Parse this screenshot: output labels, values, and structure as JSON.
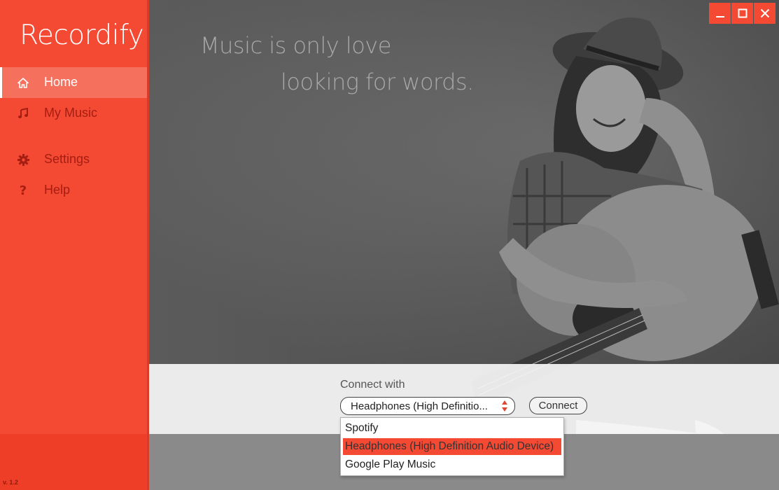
{
  "app": {
    "title": "Recordify",
    "version": "v. 1.2",
    "accent_color": "#f44a34"
  },
  "sidebar": {
    "items": [
      {
        "label": "Home",
        "icon": "home-icon",
        "active": true
      },
      {
        "label": "My Music",
        "icon": "music-note-icon",
        "active": false
      },
      {
        "label": "Settings",
        "icon": "gear-icon",
        "active": false
      },
      {
        "label": "Help",
        "icon": "question-icon",
        "active": false
      }
    ]
  },
  "hero": {
    "quote_line1": "Music is only love",
    "quote_line2": "looking for words."
  },
  "window_controls": {
    "minimize": "minimize-icon",
    "maximize": "maximize-icon",
    "close": "close-icon"
  },
  "connect": {
    "label": "Connect with",
    "selected_source": "Headphones (High Definitio...",
    "button_label": "Connect",
    "options": [
      {
        "label": "Spotify",
        "selected": false
      },
      {
        "label": "Headphones (High Definition Audio Device)",
        "selected": true
      },
      {
        "label": "Google Play Music",
        "selected": false
      }
    ]
  }
}
